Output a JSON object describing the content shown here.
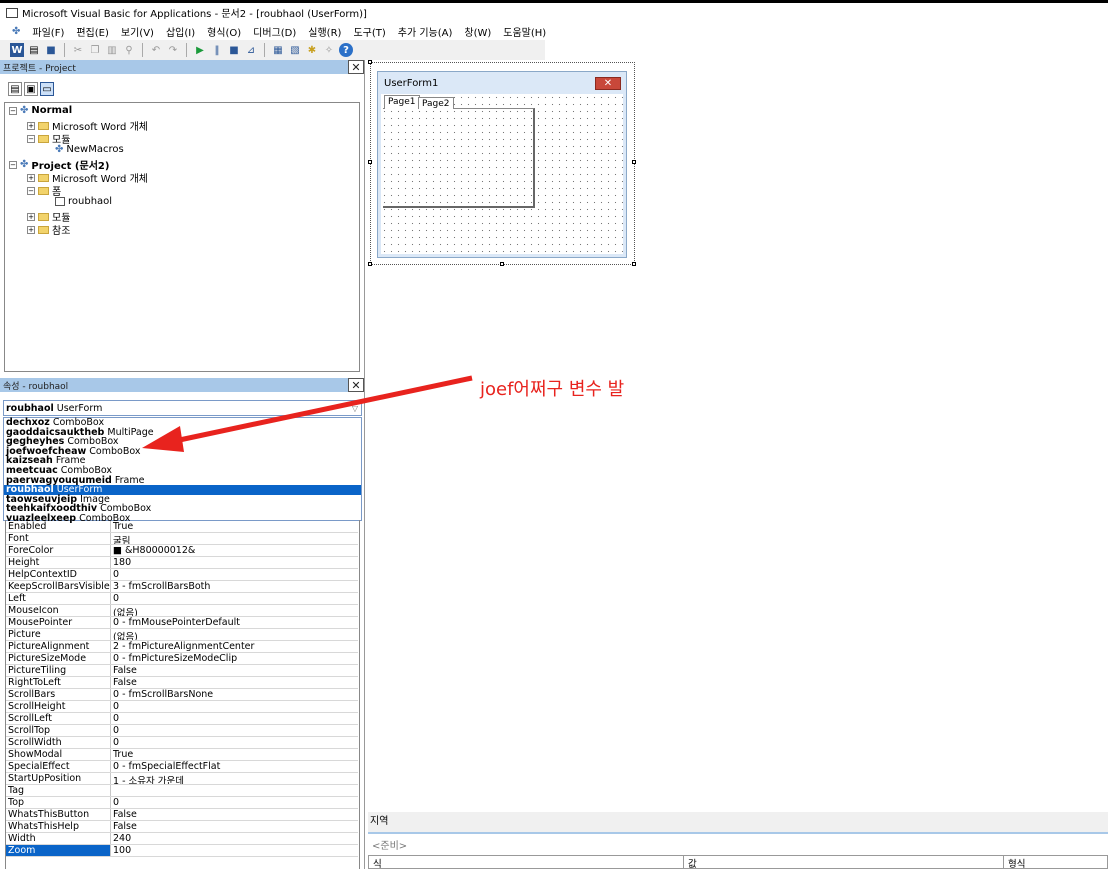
{
  "window": {
    "title": "Microsoft Visual Basic for Applications - 문서2 - [roubhaol (UserForm)]"
  },
  "menu": [
    "파일(F)",
    "편집(E)",
    "보기(V)",
    "삽입(I)",
    "형식(O)",
    "디버그(D)",
    "실행(R)",
    "도구(T)",
    "추가 기능(A)",
    "창(W)",
    "도움말(H)"
  ],
  "project_pane": {
    "title": "프로젝트 - Project",
    "tree": [
      {
        "label": "Normal",
        "bold": true,
        "level": 0
      },
      {
        "label": "Microsoft Word 개체",
        "level": 1
      },
      {
        "label": "모듈",
        "level": 1
      },
      {
        "label": "NewMacros",
        "level": 2
      },
      {
        "label": "Project (문서2)",
        "bold": true,
        "level": 0
      },
      {
        "label": "Microsoft Word 개체",
        "level": 1
      },
      {
        "label": "폼",
        "level": 1
      },
      {
        "label": "roubhaol",
        "level": 2
      },
      {
        "label": "모듈",
        "level": 1
      },
      {
        "label": "참조",
        "level": 1
      }
    ]
  },
  "props_pane": {
    "title": "속성 - roubhaol",
    "combo": {
      "name": "roubhaol",
      "type": "UserForm"
    },
    "dropdown": [
      {
        "name": "dechxoz",
        "type": "ComboBox"
      },
      {
        "name": "gaoddaicsauktheb",
        "type": "MultiPage"
      },
      {
        "name": "gegheyhes",
        "type": "ComboBox"
      },
      {
        "name": "joefwoefcheaw",
        "type": "ComboBox"
      },
      {
        "name": "kaizseah",
        "type": "Frame"
      },
      {
        "name": "meetcuac",
        "type": "ComboBox"
      },
      {
        "name": "paerwagyouqumeid",
        "type": "Frame"
      },
      {
        "name": "roubhaol",
        "type": "UserForm",
        "selected": true
      },
      {
        "name": "taowseuvjeip",
        "type": "Image"
      },
      {
        "name": "teehkaifxoodthiv",
        "type": "ComboBox"
      },
      {
        "name": "vuazleelxeep",
        "type": "ComboBox"
      }
    ],
    "rows": [
      [
        "Enabled",
        "True"
      ],
      [
        "Font",
        "굴림"
      ],
      [
        "ForeColor",
        "■ &H80000012&"
      ],
      [
        "Height",
        "180"
      ],
      [
        "HelpContextID",
        "0"
      ],
      [
        "KeepScrollBarsVisible",
        "3 - fmScrollBarsBoth"
      ],
      [
        "Left",
        "0"
      ],
      [
        "MouseIcon",
        "(없음)"
      ],
      [
        "MousePointer",
        "0 - fmMousePointerDefault"
      ],
      [
        "Picture",
        "(없음)"
      ],
      [
        "PictureAlignment",
        "2 - fmPictureAlignmentCenter"
      ],
      [
        "PictureSizeMode",
        "0 - fmPictureSizeModeClip"
      ],
      [
        "PictureTiling",
        "False"
      ],
      [
        "RightToLeft",
        "False"
      ],
      [
        "ScrollBars",
        "0 - fmScrollBarsNone"
      ],
      [
        "ScrollHeight",
        "0"
      ],
      [
        "ScrollLeft",
        "0"
      ],
      [
        "ScrollTop",
        "0"
      ],
      [
        "ScrollWidth",
        "0"
      ],
      [
        "ShowModal",
        "True"
      ],
      [
        "SpecialEffect",
        "0 - fmSpecialEffectFlat"
      ],
      [
        "StartUpPosition",
        "1 - 소유자 가운데"
      ],
      [
        "Tag",
        ""
      ],
      [
        "Top",
        "0"
      ],
      [
        "WhatsThisButton",
        "False"
      ],
      [
        "WhatsThisHelp",
        "False"
      ],
      [
        "Width",
        "240"
      ],
      [
        "Zoom",
        "100"
      ]
    ]
  },
  "designer": {
    "form_caption": "UserForm1",
    "tabs": [
      "Page1",
      "Page2"
    ]
  },
  "annotation": {
    "text": "joef어쩌구 변수 발",
    "color": "#e8231e"
  },
  "locals": {
    "title": "지역",
    "status": "<준비>",
    "columns": [
      "식",
      "값",
      "형식"
    ]
  }
}
